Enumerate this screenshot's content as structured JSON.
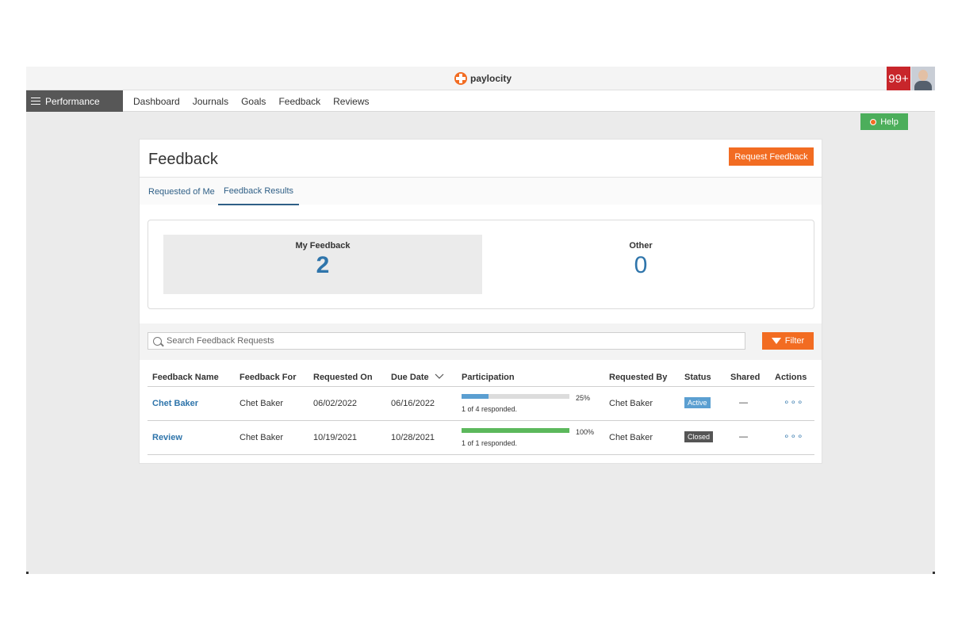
{
  "app": {
    "brand": "paylocity",
    "notification_count": "99+"
  },
  "nav": {
    "module_label": "Performance",
    "links": [
      "Dashboard",
      "Journals",
      "Goals",
      "Feedback",
      "Reviews"
    ]
  },
  "help": {
    "label": "Help"
  },
  "page": {
    "title": "Feedback",
    "request_button": "Request Feedback",
    "tabs": [
      {
        "label": "Requested of Me",
        "active": false
      },
      {
        "label": "Feedback Results",
        "active": true
      }
    ]
  },
  "summary": {
    "my_feedback": {
      "label": "My Feedback",
      "value": "2"
    },
    "other": {
      "label": "Other",
      "value": "0"
    }
  },
  "search": {
    "placeholder": "Search Feedback Requests",
    "filter_label": "Filter"
  },
  "table": {
    "columns": [
      "Feedback Name",
      "Feedback For",
      "Requested On",
      "Due Date",
      "Participation",
      "Requested By",
      "Status",
      "Shared",
      "Actions"
    ],
    "rows": [
      {
        "name": "Chet Baker",
        "for": "Chet Baker",
        "requested_on": "06/02/2022",
        "due_date": "06/16/2022",
        "participation_pct": 25,
        "participation_label": "25%",
        "responded": "1 of 4 responded.",
        "requested_by": "Chet Baker",
        "status": "Active",
        "shared": "—",
        "actions": "∘∘∘"
      },
      {
        "name": "Review",
        "for": "Chet Baker",
        "requested_on": "10/19/2021",
        "due_date": "10/28/2021",
        "participation_pct": 100,
        "participation_label": "100%",
        "responded": "1 of 1 responded.",
        "requested_by": "Chet Baker",
        "status": "Closed",
        "shared": "—",
        "actions": "∘∘∘"
      }
    ]
  },
  "colors": {
    "accent_orange": "#f26c22",
    "link_blue": "#2f75ab",
    "progress_blue": "#5b9fd1",
    "progress_green": "#5cb85c",
    "status_active": "#5b9fd1",
    "status_closed": "#555555",
    "help_green": "#4cae5b"
  },
  "icons": [
    "menu-icon",
    "search-icon",
    "filter-icon",
    "sort-chevron-down-icon",
    "more-dots-icon",
    "help-dot-icon",
    "paylocity-logo-icon"
  ]
}
